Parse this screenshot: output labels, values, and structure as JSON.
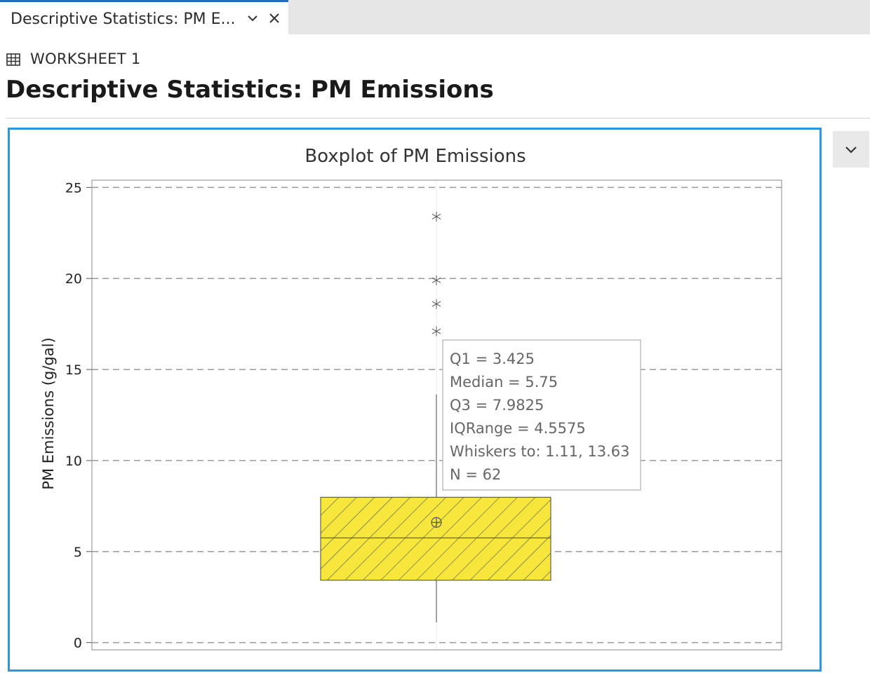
{
  "tab": {
    "label": "Descriptive Statistics: PM E..."
  },
  "worksheet": {
    "label": "WORKSHEET 1"
  },
  "page": {
    "title": "Descriptive Statistics: PM Emissions"
  },
  "icons": {
    "tab_menu": "chevron-down-icon",
    "tab_close": "close-icon",
    "worksheet": "grid-icon",
    "panel_menu": "chevron-down-icon"
  },
  "colors": {
    "frame": "#2b97dc",
    "box_fill": "#f7e63c",
    "tab_accent": "#1f6fb5"
  },
  "chart_data": {
    "type": "boxplot",
    "title": "Boxplot of PM Emissions",
    "ylabel": "PM Emissions (g/gal)",
    "ylim": [
      -0.4,
      25.4
    ],
    "yticks": [
      0,
      5,
      10,
      15,
      20,
      25
    ],
    "grid": true,
    "box": {
      "q1": 3.425,
      "median": 5.75,
      "q3": 7.9825,
      "whisker_low": 1.11,
      "whisker_high": 13.63,
      "mean": 6.6
    },
    "outliers": [
      17.1,
      18.6,
      19.9,
      23.4
    ],
    "tooltip": [
      "Q1 = 3.425",
      "Median = 5.75",
      "Q3 = 7.9825",
      "IQRange = 4.5575",
      "Whiskers to: 1.11, 13.63",
      "N = 62"
    ]
  }
}
